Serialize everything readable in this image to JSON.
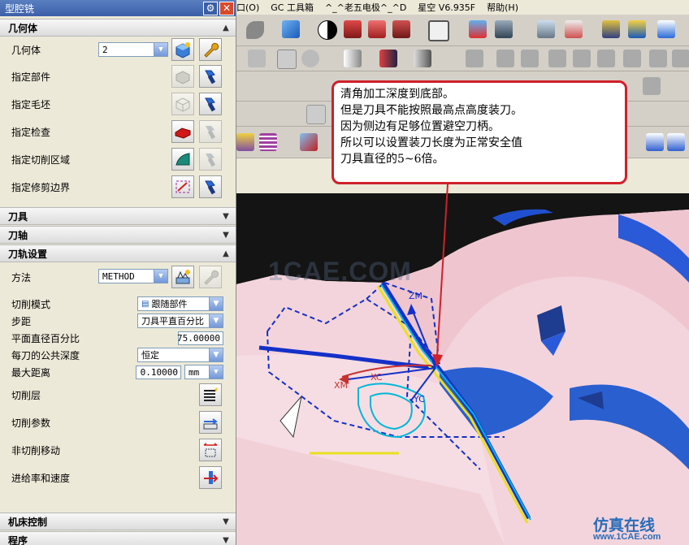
{
  "dialog": {
    "title": "型腔铣",
    "sections": {
      "geometry": "几何体",
      "tool": "刀具",
      "axis": "刀轴",
      "path": "刀轨设置",
      "machine": "机床控制",
      "program": "程序"
    },
    "geometry_label": "几何体",
    "geometry_value": "2",
    "rows": {
      "part": "指定部件",
      "blank": "指定毛坯",
      "check": "指定检查",
      "cut_area": "指定切削区域",
      "trim": "指定修剪边界"
    },
    "method_label": "方法",
    "method_value": "METHOD",
    "settings": {
      "cut_pattern_label": "切削模式",
      "cut_pattern_value": "跟随部件",
      "stepover_label": "步距",
      "stepover_value": "刀具平直百分比",
      "flat_diam_label": "平面直径百分比",
      "flat_diam_value": "75.00000",
      "depth_label": "每刀的公共深度",
      "depth_value": "恒定",
      "max_dist_label": "最大距离",
      "max_dist_value": "0.10000",
      "max_dist_unit": "mm",
      "cut_levels": "切削层",
      "cut_params": "切削参数",
      "non_cut": "非切削移动",
      "feeds": "进给率和速度"
    }
  },
  "menubar": {
    "items": [
      "口(O)",
      "GC 工具箱",
      "^_^老五电极^_^D",
      "星空 V6.935F",
      "帮助(H)"
    ]
  },
  "callout": {
    "lines": [
      "清角加工深度到底部。",
      "但是刀具不能按照最高点高度装刀。",
      "因为侧边有足够位置避空刀柄。",
      "所以可以设置装刀长度为正常安全值",
      "刀具直径的5~6倍。"
    ]
  },
  "viewport": {
    "axis_labels": {
      "zm": "ZM",
      "xm": "XM",
      "xc": "XC",
      "yc": "YC"
    }
  },
  "watermarks": {
    "center": "1CAE.COM",
    "brand_cn": "仿真在线",
    "brand_url": "www.1CAE.com"
  },
  "colors": {
    "title_bar": "#3c5fa8",
    "callout_border": "#d0202a",
    "part_pink": "#f3c6cc",
    "part_blue": "#2a5fd0",
    "toolpath_blue": "#1430c8"
  }
}
